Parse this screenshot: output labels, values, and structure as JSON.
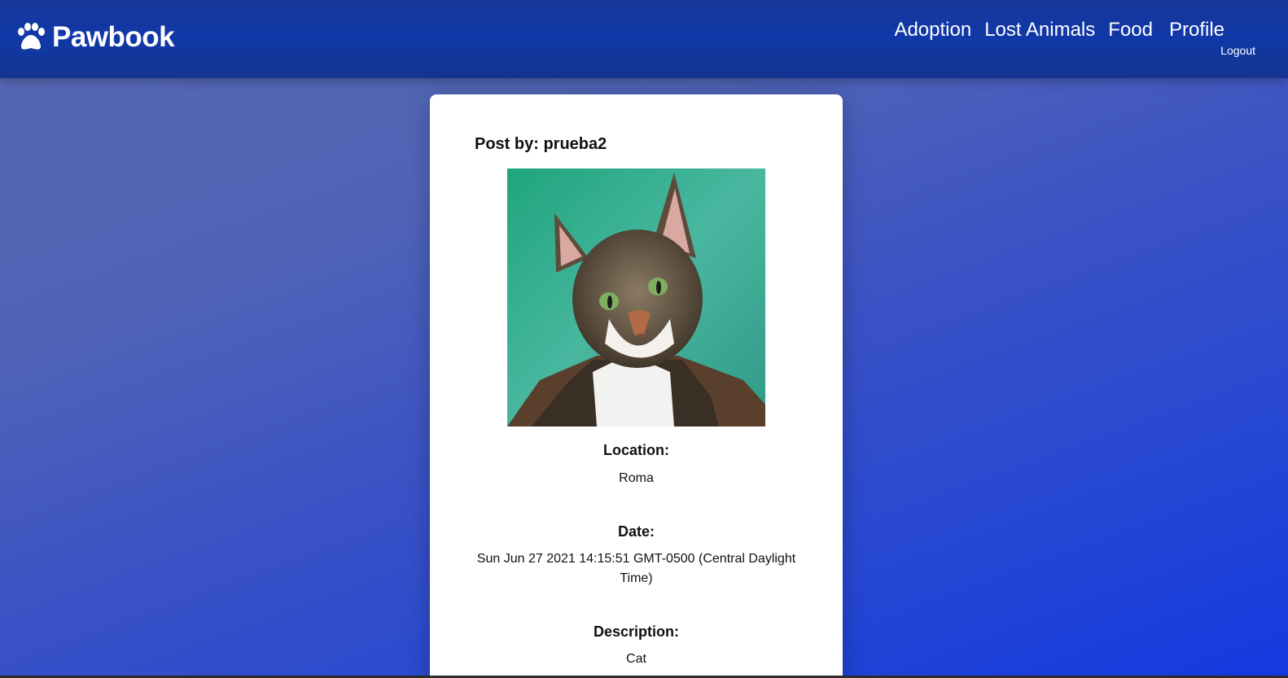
{
  "header": {
    "brand": "Pawbook",
    "brand_icon": "paw-icon",
    "nav": {
      "adoption": "Adoption",
      "lost_animals": "Lost Animals",
      "food": "Food",
      "profile": "Profile"
    },
    "logout": "Logout"
  },
  "post": {
    "author_line": "Post by: prueba2",
    "image_alt": "Tabby and white cat",
    "location_label": "Location:",
    "location_value": "Roma",
    "date_label": "Date:",
    "date_value": "Sun Jun 27 2021 14:15:51 GMT-0500 (Central Daylight Time)",
    "description_label": "Description:",
    "description_value": "Cat"
  },
  "colors": {
    "navbar": "#1038a8",
    "background_start": "#5567b1",
    "background_end": "#1439e0",
    "card": "#ffffff"
  }
}
